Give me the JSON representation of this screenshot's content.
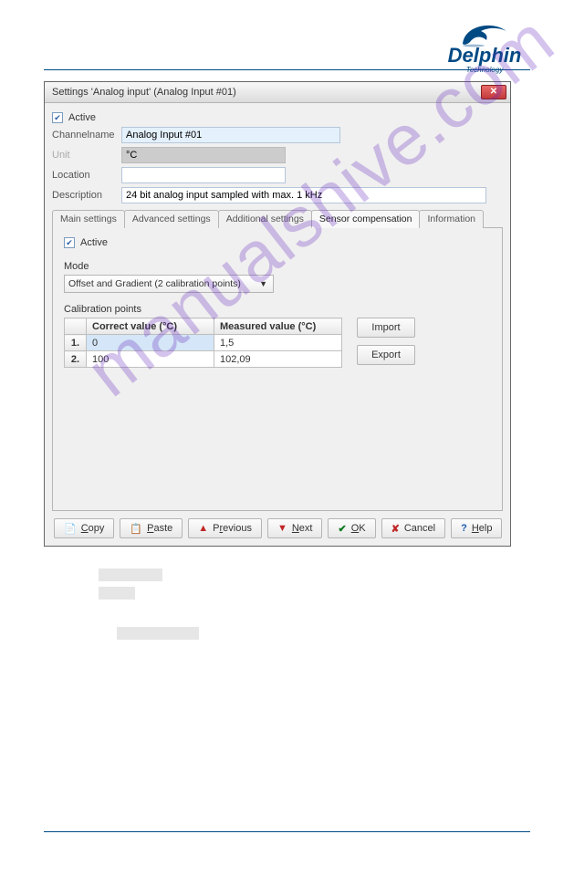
{
  "logo": {
    "brand": "Delphin",
    "sub": "Technology"
  },
  "watermark": "manualshive.com",
  "window": {
    "title": "Settings 'Analog input' (Analog Input #01)",
    "active_label": "Active",
    "fields": {
      "channelname_label": "Channelname",
      "channelname_value": "Analog Input #01",
      "unit_label": "Unit",
      "unit_value": "°C",
      "location_label": "Location",
      "location_value": "",
      "description_label": "Description",
      "description_value": "24 bit analog input sampled with max. 1 kHz"
    },
    "tabs": [
      "Main settings",
      "Advanced settings",
      "Additional settings",
      "Sensor compensation",
      "Information"
    ],
    "active_tab": "Sensor compensation",
    "sensor_comp": {
      "inner_active_label": "Active",
      "mode_label": "Mode",
      "mode_value": "Offset and Gradient (2 calibration points)",
      "calib_label": "Calibration points",
      "columns": {
        "num": "",
        "correct": "Correct value (°C)",
        "measured": "Measured value (°C)"
      },
      "rows": [
        {
          "n": "1.",
          "correct": "0",
          "measured": "1,5"
        },
        {
          "n": "2.",
          "correct": "100",
          "measured": "102,09"
        }
      ],
      "import_btn": "Import",
      "export_btn": "Export"
    },
    "buttons": {
      "copy": "Copy",
      "paste": "Paste",
      "previous": "Previous",
      "next": "Next",
      "ok": "OK",
      "cancel": "Cancel",
      "help": "Help"
    }
  },
  "chart_data": {
    "type": "table",
    "title": "Calibration points",
    "columns": [
      "Correct value (°C)",
      "Measured value (°C)"
    ],
    "rows": [
      [
        0,
        1.5
      ],
      [
        100,
        102.09
      ]
    ]
  }
}
